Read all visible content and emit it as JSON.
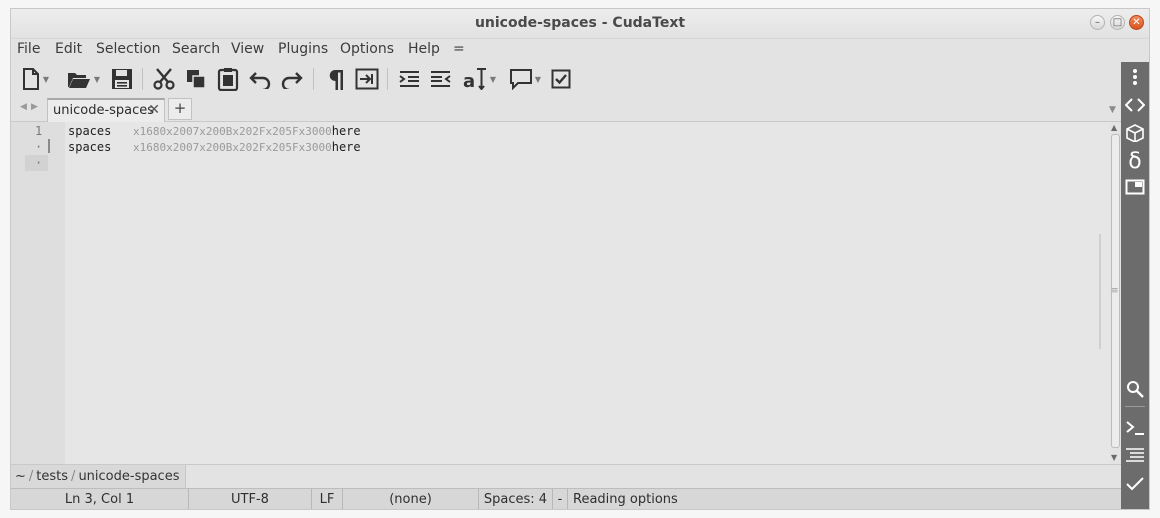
{
  "window": {
    "title": "unicode-spaces - CudaText"
  },
  "menu": [
    "File",
    "Edit",
    "Selection",
    "Search",
    "View",
    "Plugins",
    "Options",
    "Help",
    "="
  ],
  "tabs": {
    "active_label": "unicode-spaces",
    "close_glyph": "✕",
    "add_glyph": "+"
  },
  "editor": {
    "gutter": [
      "1",
      "·",
      "·"
    ],
    "lines": [
      {
        "word": "spaces",
        "codes": "x1680x2007x200Bx202Fx205Fx3000",
        "tail": "here"
      },
      {
        "word": "spaces",
        "codes": "x1680x2007x200Bx202Fx205Fx3000",
        "tail": "here"
      }
    ]
  },
  "path": {
    "parts": [
      "~",
      "tests",
      "unicode-spaces"
    ],
    "separator": "/"
  },
  "status": {
    "position": "Ln 3, Col 1",
    "encoding": "UTF-8",
    "line_ending": "LF",
    "lexer": "(none)",
    "tabs": "Spaces: 4",
    "dash": "-",
    "message": "Reading options"
  },
  "colors": {
    "sidebar": "#6c6c6c",
    "close_button": "#e2601f"
  }
}
